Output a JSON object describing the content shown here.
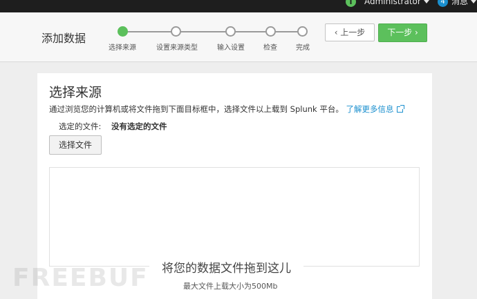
{
  "topbar": {
    "info_icon": "i",
    "user": "Administrator",
    "message_count": "4",
    "message_label": "消息"
  },
  "header": {
    "title": "添加数据",
    "steps": [
      {
        "label": "选择来源"
      },
      {
        "label": "设置来源类型"
      },
      {
        "label": "输入设置"
      },
      {
        "label": "检查"
      },
      {
        "label": "完成"
      }
    ],
    "prev_label": "‹ 上一步",
    "next_label": "下一步 ›"
  },
  "panel": {
    "title": "选择来源",
    "description": "通过浏览您的计算机或将文件拖到下面目标框中，选择文件以上载到 Splunk 平台。",
    "learn_more": "了解更多信息",
    "selected_label": "选定的文件:",
    "selected_value": "没有选定的文件",
    "choose_button": "选择文件",
    "drop_title": "将您的数据文件拖到这儿",
    "drop_subtitle": "最大文件上载大小为500Mb"
  },
  "watermark": "FREEBUF",
  "colors": {
    "accent_green": "#5cc05c",
    "link_blue": "#1a8fce",
    "topbar_bg": "#1e1e1e"
  }
}
